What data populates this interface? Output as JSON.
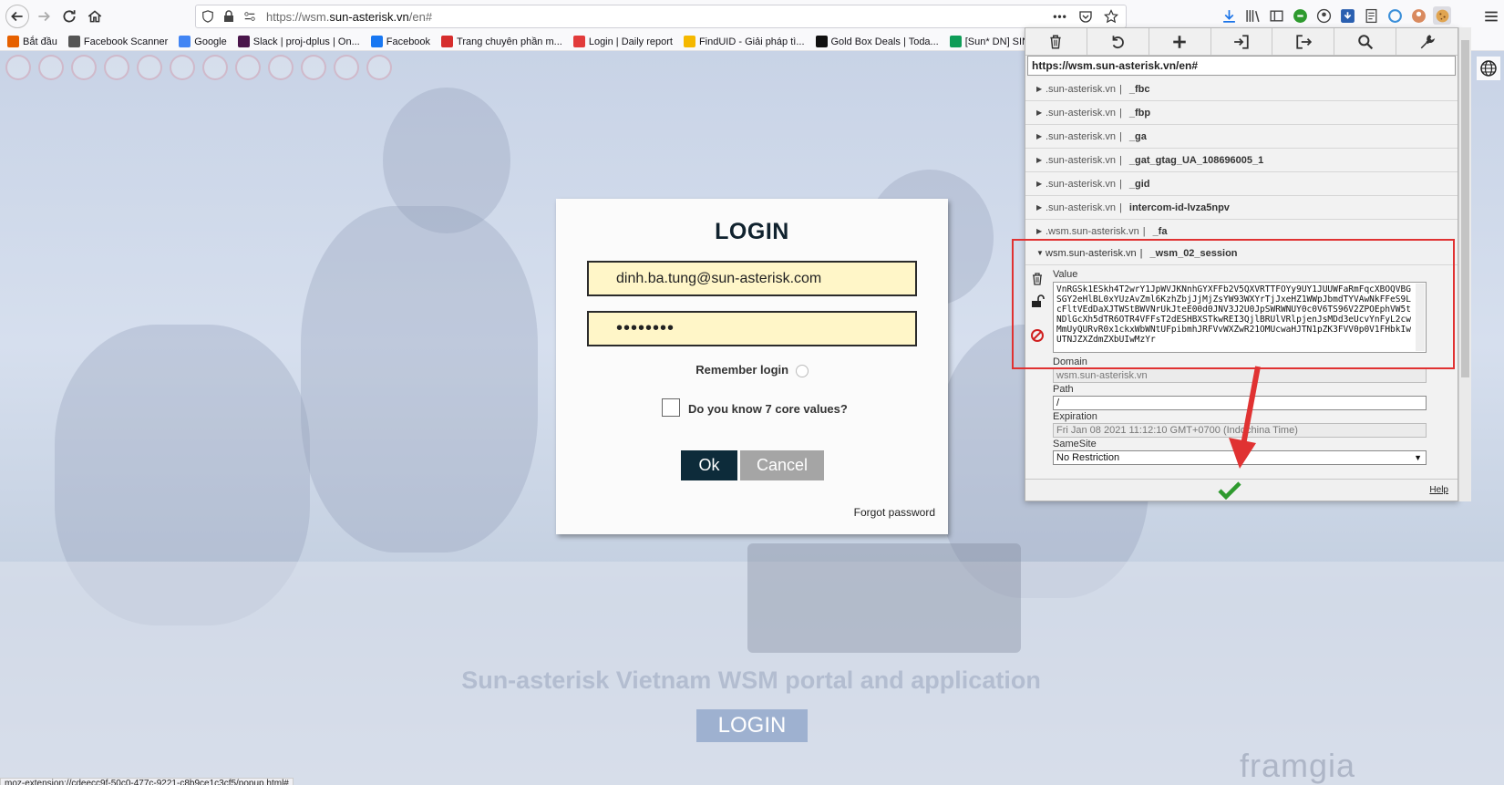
{
  "browser": {
    "url_prefix": "https://wsm.",
    "url_domain": "sun-asterisk.vn",
    "url_suffix": "/en#"
  },
  "bookmarks": [
    {
      "label": "Bắt đầu",
      "color": "#e66000"
    },
    {
      "label": "Facebook Scanner",
      "color": "#555555"
    },
    {
      "label": "Google",
      "color": "#4285f4"
    },
    {
      "label": "Slack | proj-dplus | On...",
      "color": "#4a154b"
    },
    {
      "label": "Facebook",
      "color": "#1877f2"
    },
    {
      "label": "Trang chuyên phần m...",
      "color": "#d62d2d"
    },
    {
      "label": "Login | Daily report",
      "color": "#e23b3b"
    },
    {
      "label": "FindUID - Giải pháp tì...",
      "color": "#f5b800"
    },
    {
      "label": "Gold Box Deals | Toda...",
      "color": "#111111"
    },
    {
      "label": "[Sun* DN] SINH NHẬT...",
      "color": "#0f9d58"
    }
  ],
  "login": {
    "title": "LOGIN",
    "email": "dinh.ba.tung@sun-asterisk.com",
    "password_mask": "••••••••",
    "remember": "Remember login",
    "core_values": "Do you know 7 core values?",
    "ok": "Ok",
    "cancel": "Cancel",
    "forgot": "Forgot password"
  },
  "portal": {
    "title": "Sun-asterisk Vietnam WSM portal and application",
    "login": "LOGIN",
    "watermark": "framgia"
  },
  "status_url": "moz-extension://cdeecc9f-50c0-477c-9221-c8b9ce1c3cf5/popup.html#",
  "cookie_panel": {
    "url": "https://wsm.sun-asterisk.vn/en#",
    "cookies": [
      {
        "domain": ".sun-asterisk.vn",
        "name": "_fbc"
      },
      {
        "domain": ".sun-asterisk.vn",
        "name": "_fbp"
      },
      {
        "domain": ".sun-asterisk.vn",
        "name": "_ga"
      },
      {
        "domain": ".sun-asterisk.vn",
        "name": "_gat_gtag_UA_108696005_1"
      },
      {
        "domain": ".sun-asterisk.vn",
        "name": "_gid"
      },
      {
        "domain": ".sun-asterisk.vn",
        "name": "intercom-id-lvza5npv"
      },
      {
        "domain": ".wsm.sun-asterisk.vn",
        "name": "_fa"
      }
    ],
    "expanded": {
      "domain": "wsm.sun-asterisk.vn",
      "name": "_wsm_02_session",
      "value_label": "Value",
      "value": "VnRGSk1ESkh4T2wrY1JpWVJKNnhGYXFFb2V5QXVRTTFOYy9UY1JUUWFaRmFqcXBOQVBGSGY2eHlBL0xYUzAvZml6KzhZbjJjMjZsYW93WXYrTjJxeHZ1WWpJbmdTYVAwNkFFeS9LcFltVEdDaXJTWStBWVNrUkJteE00d0JNV3J2U0JpSWRWNUY0c0V6TS96V2ZPOEphVW5tNDlGcXh5dTR6OTR4VFFsT2dESHBXSTkwREI3QjlBRUlVRlpjenJsMDd3eUcvYnFyL2cwMmUyQURvR0x1ckxWbWNtUFpibmhJRFVvWXZwR21OMUcwaHJTN1pZK3FVV0p0V1FHbkIwUTNJZXZdmZXbUIwMzYr",
      "domain_label": "Domain",
      "domain_value": "wsm.sun-asterisk.vn",
      "path_label": "Path",
      "path_value": "/",
      "expiration_label": "Expiration",
      "expiration_value": "Fri Jan 08 2021 11:12:10 GMT+0700 (Indochina Time)",
      "samesite_label": "SameSite",
      "samesite_value": "No Restriction"
    },
    "help": "Help"
  },
  "colors": {
    "highlight": "#e03232",
    "save_check": "#2e9a2e",
    "ok_button": "#0d2b3a"
  }
}
